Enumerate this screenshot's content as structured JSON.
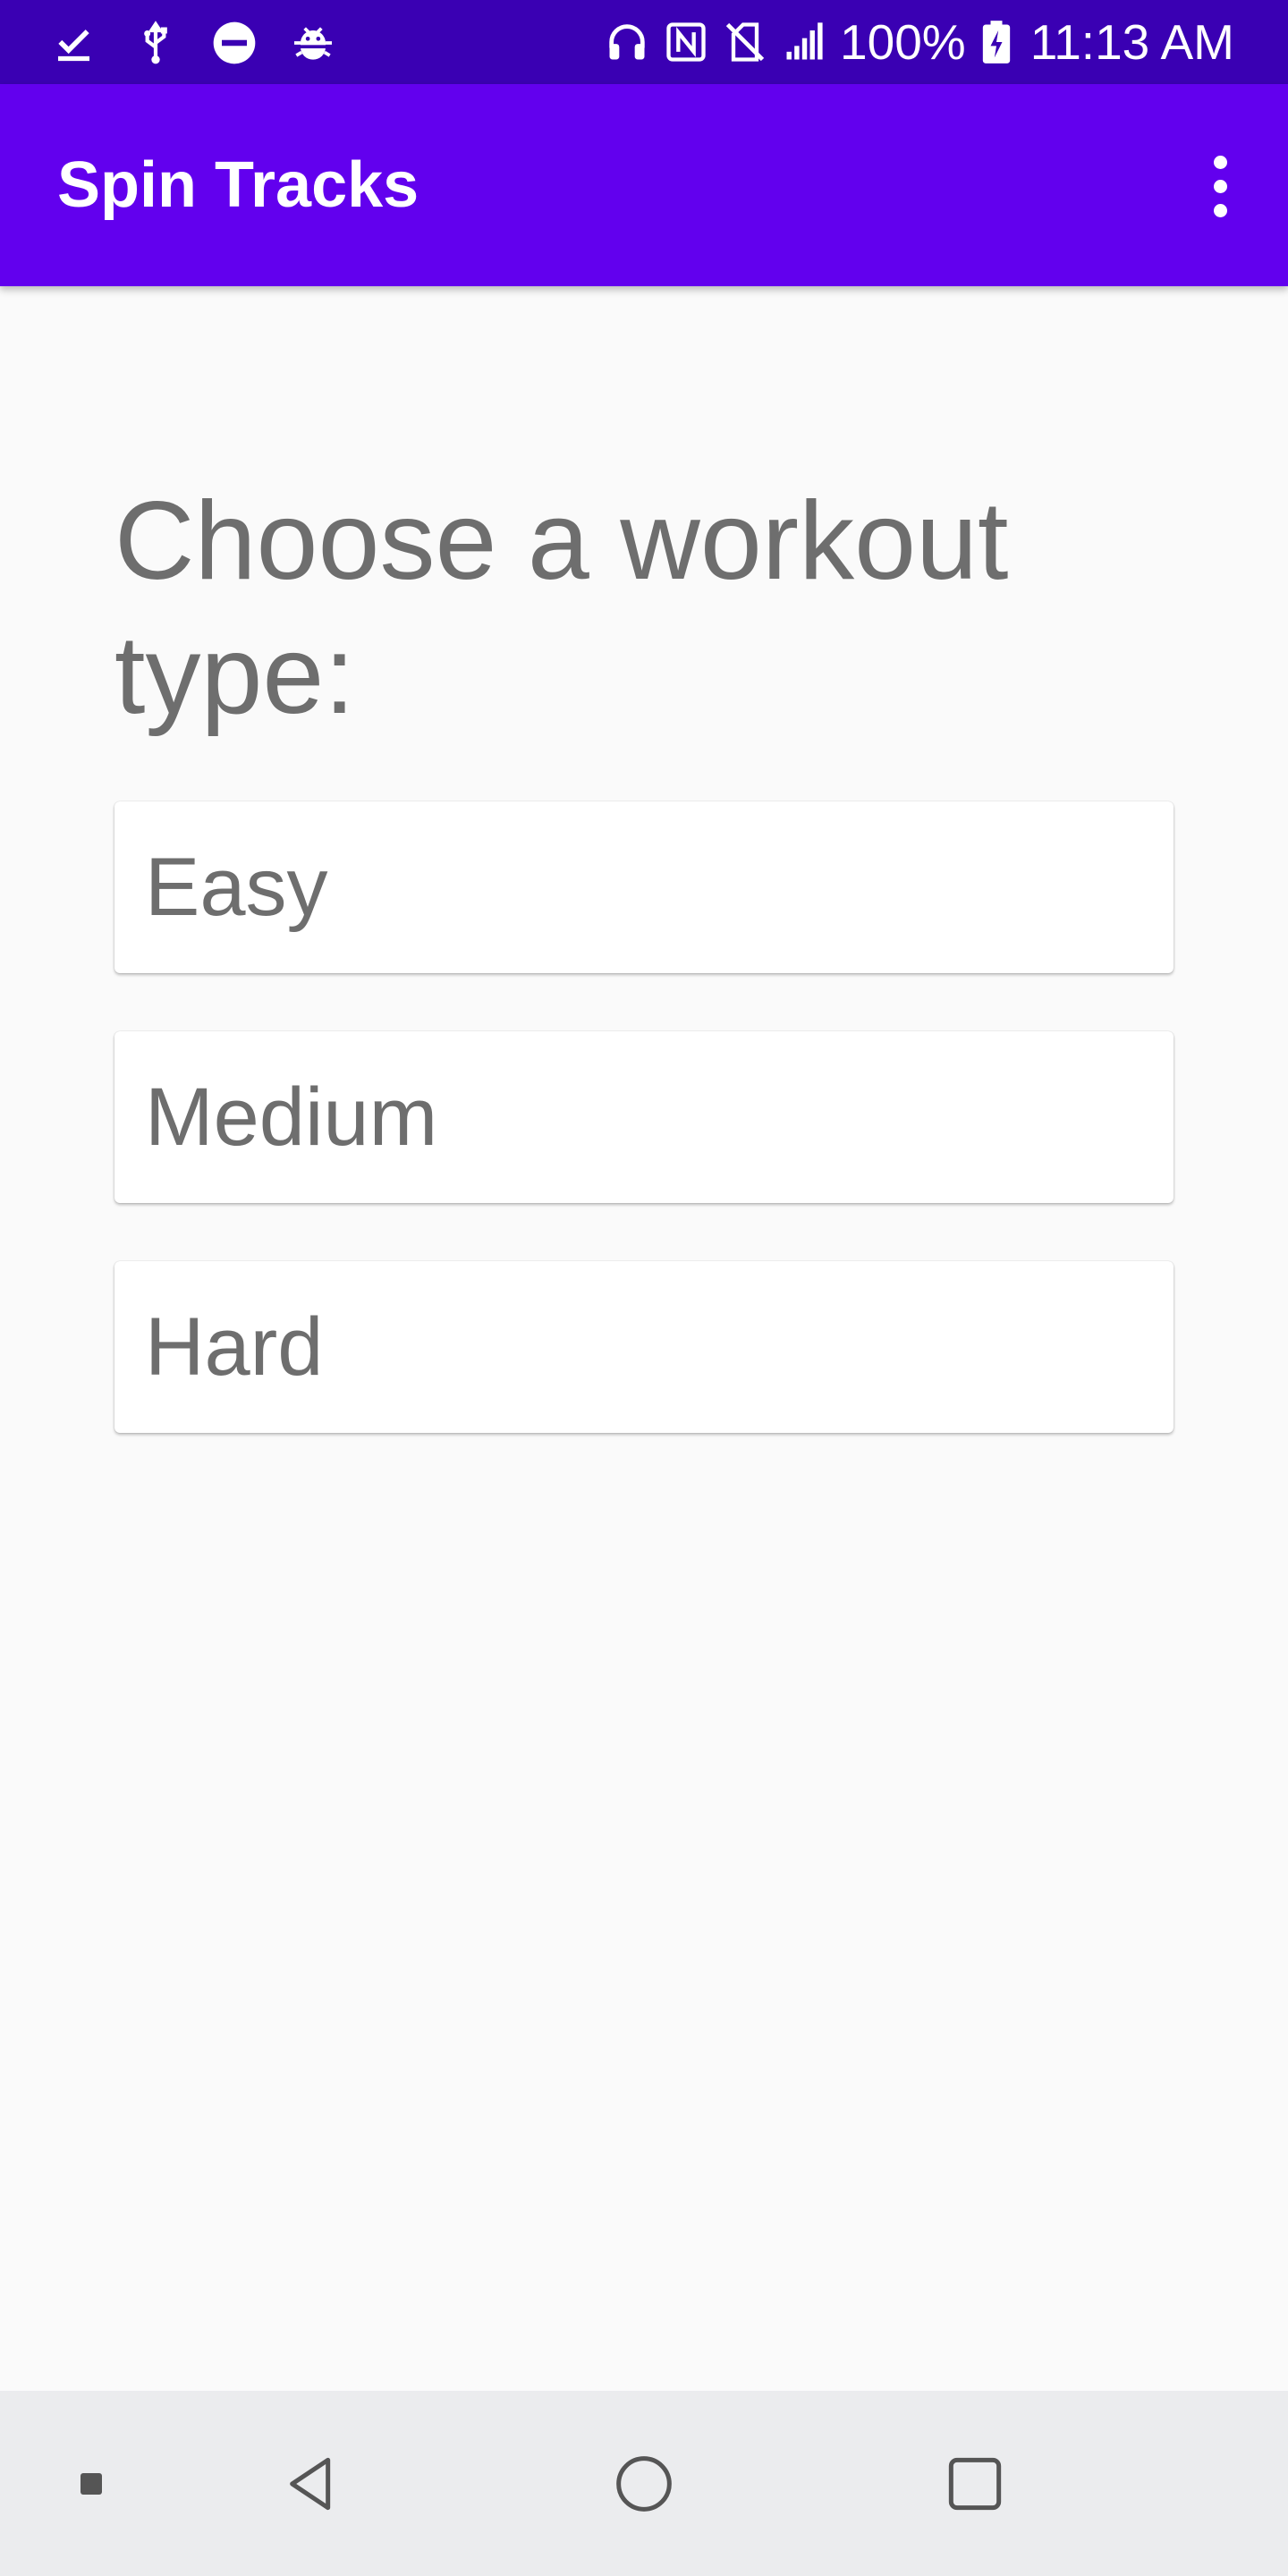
{
  "status_bar": {
    "battery": "100%",
    "time": "11:13 AM",
    "left_icons": [
      "check-icon",
      "usb-icon",
      "do-not-disturb-icon",
      "debug-icon"
    ],
    "right_icons": [
      "headset-icon",
      "nfc-icon",
      "no-sim-icon",
      "signal-icon",
      "battery-charging-icon"
    ]
  },
  "app_bar": {
    "title": "Spin Tracks",
    "menu_icon": "more-vert-icon"
  },
  "main": {
    "prompt": "Choose a workout type:",
    "options": [
      {
        "label": "Easy"
      },
      {
        "label": "Medium"
      },
      {
        "label": "Hard"
      }
    ]
  },
  "nav_bar": {
    "buttons": [
      "square-small-icon",
      "back-icon",
      "home-icon",
      "recents-icon"
    ]
  },
  "colors": {
    "status_bar": "#3a00b3",
    "app_bar": "#6200ee",
    "background": "#fafafa",
    "text_gray": "#6e6e6e",
    "nav_bar": "#ebecee"
  }
}
